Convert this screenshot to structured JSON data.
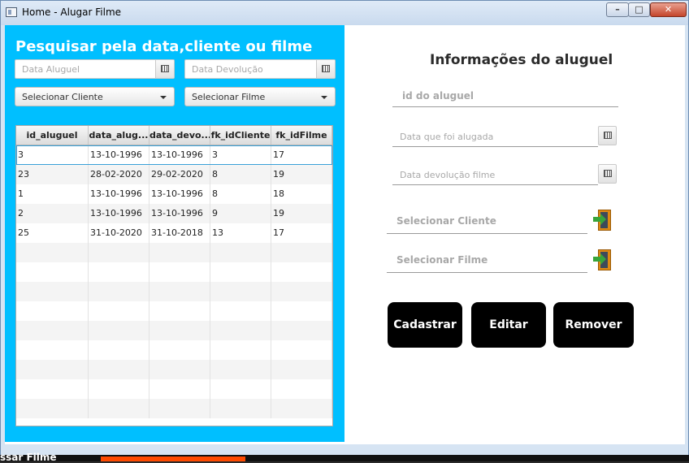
{
  "window": {
    "title": "Home - Alugar Filme",
    "minimize_label": "–",
    "maximize_label": "□",
    "close_label": "✕"
  },
  "search": {
    "heading": "Pesquisar pela data,cliente ou filme",
    "date_rent_placeholder": "Data Aluguel",
    "date_return_placeholder": "Data Devolução",
    "client_select": "Selecionar Cliente",
    "film_select": "Selecionar Filme"
  },
  "table": {
    "columns": [
      "id_aluguel",
      "data_alug...",
      "data_devo...",
      "fk_idCliente",
      "fk_idFilme"
    ],
    "rows": [
      [
        "3",
        "13-10-1996",
        "13-10-1996",
        "3",
        "17"
      ],
      [
        "23",
        "28-02-2020",
        "29-02-2020",
        "8",
        "19"
      ],
      [
        "1",
        "13-10-1996",
        "13-10-1996",
        "8",
        "18"
      ],
      [
        "2",
        "13-10-1996",
        "13-10-1996",
        "9",
        "19"
      ],
      [
        "25",
        "31-10-2020",
        "31-10-2018",
        "13",
        "17"
      ]
    ],
    "selected_row": 0
  },
  "form": {
    "heading": "Informações do aluguel",
    "id_placeholder": "id do aluguel",
    "date_rented_placeholder": "Data que foi alugada",
    "date_return_placeholder": "Data devolução filme",
    "client_label": "Selecionar Cliente",
    "film_label": "Selecionar Filme"
  },
  "actions": {
    "register": "Cadastrar",
    "edit": "Editar",
    "remove": "Remover"
  },
  "background_peek": {
    "text": "ssar Filme"
  },
  "colors": {
    "left_panel": "#00bfff",
    "button": "#000000"
  }
}
